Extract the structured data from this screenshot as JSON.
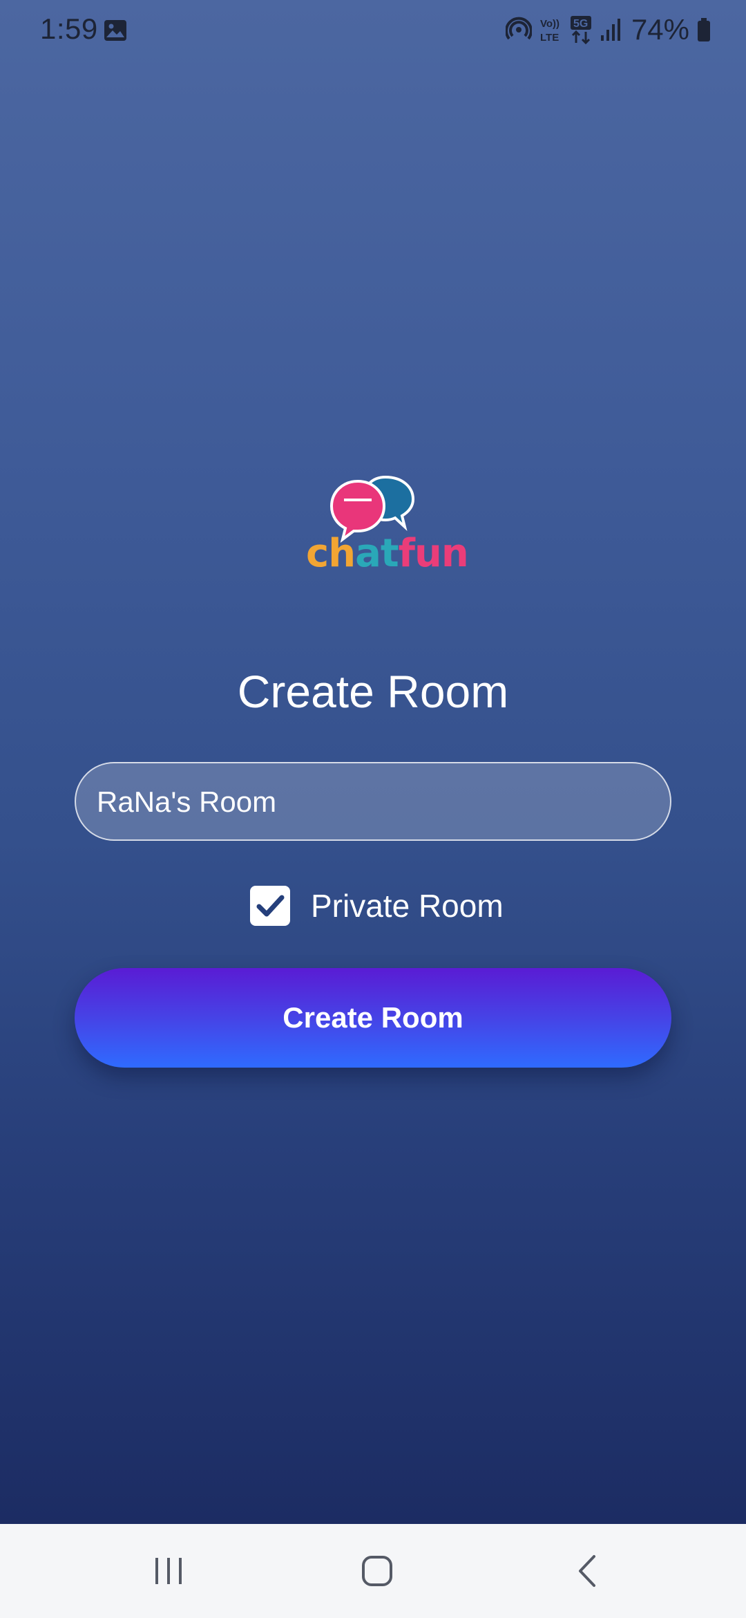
{
  "status_bar": {
    "time": "1:59",
    "battery_percent": "74%",
    "icons": [
      "gallery-icon",
      "hotspot-icon",
      "volte-icon",
      "5g-icon",
      "signal-icon",
      "battery-icon"
    ]
  },
  "logo": {
    "text_part1": "ch",
    "text_part2": "at",
    "text_part3": "fun",
    "colors": {
      "orange": "#f2a533",
      "teal": "#2aa8b8",
      "pink": "#ea3d79"
    }
  },
  "page": {
    "title": "Create Room"
  },
  "form": {
    "room_name_value": "RaNa's Room",
    "private_label": "Private Room",
    "private_checked": true,
    "submit_label": "Create Room"
  },
  "nav_bar": {
    "buttons": [
      "recent-apps",
      "home",
      "back"
    ]
  },
  "colors": {
    "bg_top": "#4c67a1",
    "bg_bottom": "#1c2c63",
    "button_top": "#5a1cd4",
    "button_bottom": "#2f6bff"
  }
}
